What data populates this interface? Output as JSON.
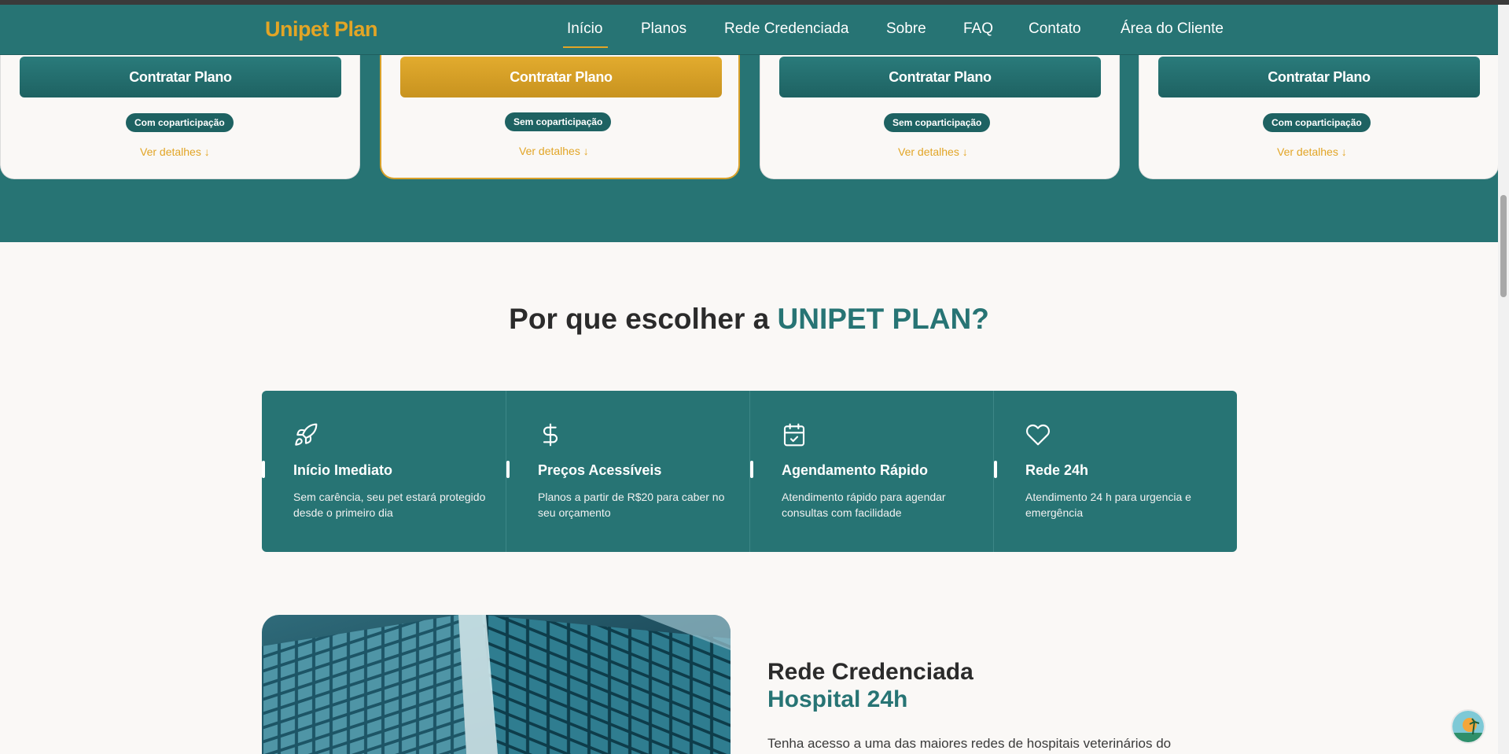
{
  "header": {
    "logo": "Unipet Plan",
    "nav": [
      {
        "label": "Início",
        "active": true
      },
      {
        "label": "Planos"
      },
      {
        "label": "Rede Credenciada"
      },
      {
        "label": "Sobre"
      },
      {
        "label": "FAQ"
      },
      {
        "label": "Contato"
      },
      {
        "label": "Área do Cliente"
      }
    ]
  },
  "plans": [
    {
      "button": "Contratar Plano",
      "badge": "Com coparticipação",
      "details": "Ver detalhes ↓",
      "featured": false
    },
    {
      "button": "Contratar Plano",
      "badge": "Sem coparticipação",
      "details": "Ver detalhes ↓",
      "featured": true
    },
    {
      "button": "Contratar Plano",
      "badge": "Sem coparticipação",
      "details": "Ver detalhes ↓",
      "featured": false
    },
    {
      "button": "Contratar Plano",
      "badge": "Com coparticipação",
      "details": "Ver detalhes ↓",
      "featured": false
    }
  ],
  "why": {
    "title_prefix": "Por que escolher a ",
    "title_accent": "UNIPET PLAN?",
    "features": [
      {
        "icon": "rocket-icon",
        "title": "Início Imediato",
        "text": "Sem carência, seu pet estará protegido desde o primeiro dia"
      },
      {
        "icon": "dollar-icon",
        "title": "Preços Acessíveis",
        "text": "Planos a partir de R$20 para caber no seu orçamento"
      },
      {
        "icon": "calendar-check-icon",
        "title": "Agendamento Rápido",
        "text": "Atendimento rápido para agendar consultas com facilidade"
      },
      {
        "icon": "heart-icon",
        "title": "Rede 24h",
        "text": "Atendimento 24 h para urgencia e emergência"
      }
    ]
  },
  "network": {
    "title": "Rede Credenciada",
    "subtitle": "Hospital 24h",
    "text": "Tenha acesso a uma das maiores redes de hospitais veterinários do"
  },
  "colors": {
    "primary": "#277474",
    "accent": "#e2a526",
    "background": "#faf8f6"
  }
}
